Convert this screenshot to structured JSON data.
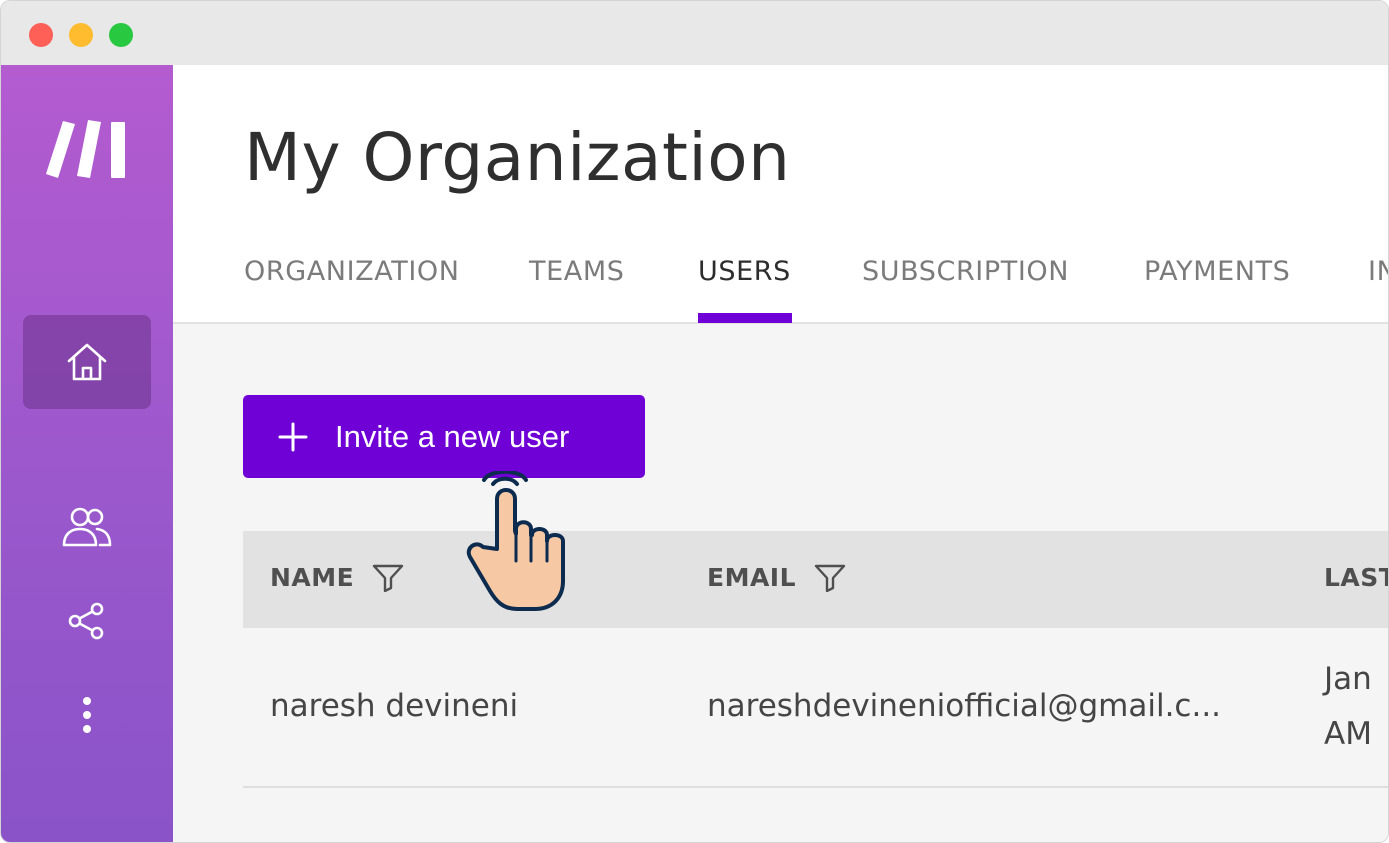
{
  "window": {
    "controls": [
      "close",
      "minimize",
      "maximize"
    ]
  },
  "sidebar": {
    "logo": "make-logo",
    "items": [
      {
        "icon": "home-icon",
        "active": true
      },
      {
        "icon": "users-icon",
        "active": false
      },
      {
        "icon": "share-icon",
        "active": false
      },
      {
        "icon": "more-vertical-icon",
        "active": false
      }
    ]
  },
  "header": {
    "title": "My Organization",
    "tabs": [
      {
        "label": "ORGANIZATION",
        "active": false
      },
      {
        "label": "TEAMS",
        "active": false
      },
      {
        "label": "USERS",
        "active": true
      },
      {
        "label": "SUBSCRIPTION",
        "active": false
      },
      {
        "label": "PAYMENTS",
        "active": false
      },
      {
        "label": "IN",
        "active": false
      }
    ]
  },
  "actions": {
    "invite_label": "Invite a new user",
    "invite_icon": "plus-icon"
  },
  "table": {
    "columns": [
      "NAME",
      "EMAIL",
      "LAST"
    ],
    "rows": [
      {
        "name": "naresh devineni",
        "email": "nareshdevineniofficial@gmail.c...",
        "last_line1": "Jan",
        "last_line2": "AM"
      }
    ]
  },
  "colors": {
    "accent": "#6f00d6",
    "sidebar_top": "#b45bd0",
    "sidebar_bottom": "#8a53c8",
    "cursor_skin": "#f6c9a4",
    "cursor_outline": "#0d2b4f"
  },
  "overlay": {
    "cursor": "hand-pointer-icon"
  }
}
